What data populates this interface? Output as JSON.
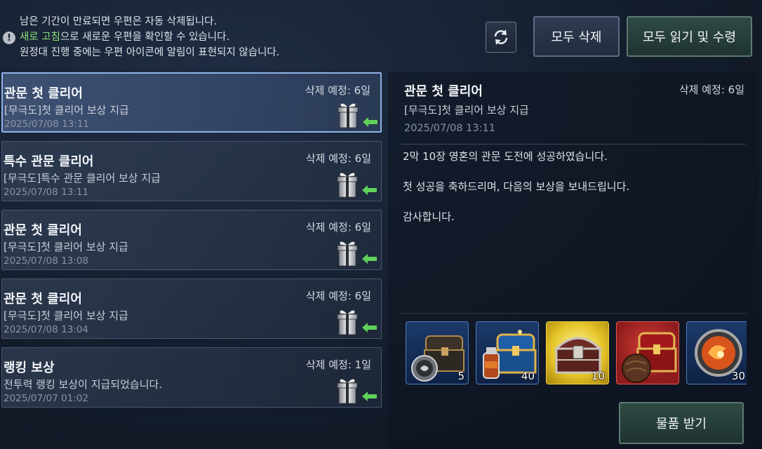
{
  "notice": {
    "line1": "남은 기간이 만료되면 우편은 자동 삭제됩니다.",
    "line2_highlight": "새로 고침",
    "line2_rest": "으로 새로운 우편을 확인할 수 있습니다.",
    "line3": "원정대 진행 중에는 우편 아이콘에 알림이 표현되지 않습니다."
  },
  "toolbar": {
    "delete_all": "모두 삭제",
    "read_all_claim": "모두 읽기 및 수령"
  },
  "mails": [
    {
      "title": "관문 첫 클리어",
      "subtitle": "[무극도]첫 클리어 보상 지급",
      "date": "2025/07/08 13:11",
      "expire": "삭제 예정: 6일"
    },
    {
      "title": "특수 관문 클리어",
      "subtitle": "[무극도]특수 관문 클리어 보상 지급",
      "date": "2025/07/08 13:11",
      "expire": "삭제 예정: 6일"
    },
    {
      "title": "관문 첫 클리어",
      "subtitle": "[무극도]첫 클리어 보상 지급",
      "date": "2025/07/08 13:08",
      "expire": "삭제 예정: 6일"
    },
    {
      "title": "관문 첫 클리어",
      "subtitle": "[무극도]첫 클리어 보상 지급",
      "date": "2025/07/08 13:04",
      "expire": "삭제 예정: 6일"
    },
    {
      "title": "랭킹 보상",
      "subtitle": "전투력 랭킹 보상이 지급되었습니다.",
      "date": "2025/07/07 01:02",
      "expire": "삭제 예정: 1일"
    }
  ],
  "detail": {
    "title": "관문 첫 클리어",
    "expire": "삭제 예정: 6일",
    "subtitle": "[무극도]첫 클리어 보상 지급",
    "date": "2025/07/08 13:11",
    "body": [
      "2막 10장 영혼의 관문 도전에 성공하였습니다.",
      "첫 성공을 축하드리며, 다음의 보상을 보내드립니다.",
      "감사합니다."
    ],
    "rewards": [
      {
        "icon": "dark-chest-with-coin-icon",
        "qty": "5",
        "frame_color": "#3d6fb0"
      },
      {
        "icon": "blue-gold-chest-with-potion-icon",
        "qty": "40",
        "frame_color": "#3d6fb0"
      },
      {
        "icon": "ornate-treasure-chest-icon",
        "qty": "10",
        "frame_color": "#d9b323"
      },
      {
        "icon": "red-chest-with-pouch-icon",
        "qty": "",
        "frame_color": "#c23a3a"
      },
      {
        "icon": "fire-orb-icon",
        "qty": "30",
        "frame_color": "#3d6fb0"
      }
    ],
    "claim_label": "물품 받기"
  }
}
